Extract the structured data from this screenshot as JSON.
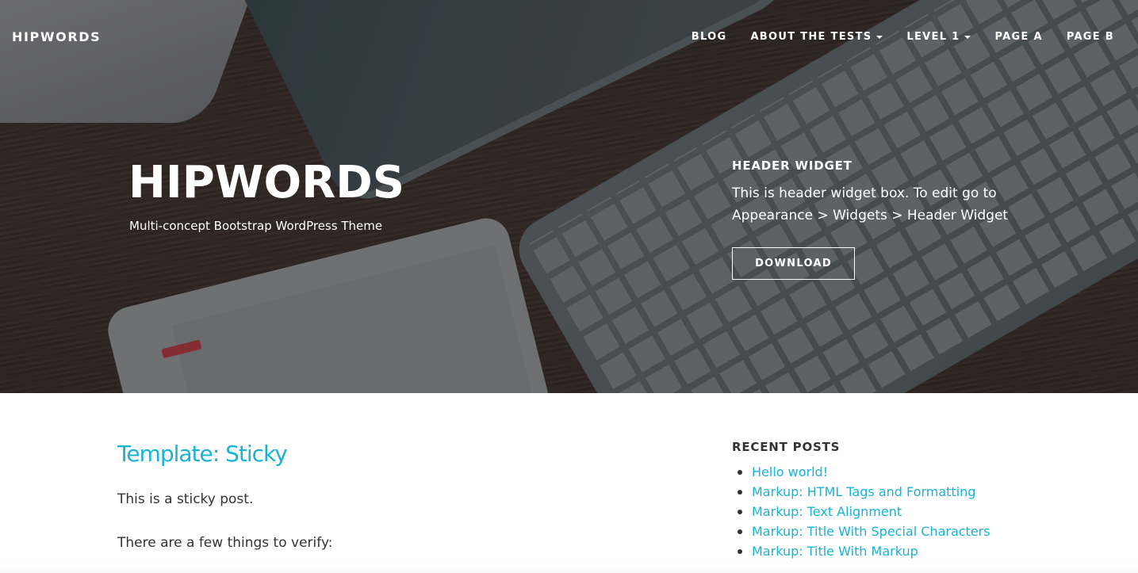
{
  "navbar": {
    "brand": "HIPWORDS",
    "items": [
      {
        "label": "BLOG",
        "has_dropdown": false
      },
      {
        "label": "ABOUT THE TESTS",
        "has_dropdown": true
      },
      {
        "label": "LEVEL 1",
        "has_dropdown": true
      },
      {
        "label": "PAGE A",
        "has_dropdown": false
      },
      {
        "label": "PAGE B",
        "has_dropdown": false
      }
    ]
  },
  "hero": {
    "title": "HIPWORDS",
    "tagline": "Multi-concept Bootstrap WordPress Theme",
    "widget": {
      "title": "HEADER WIDGET",
      "text": "This is header widget box. To edit go to Appearance > Widgets > Header Widget",
      "button_label": "DOWNLOAD"
    }
  },
  "post": {
    "title": "Template: Sticky",
    "paragraphs": [
      "This is a sticky post.",
      "There are a few things to verify:"
    ]
  },
  "sidebar": {
    "recent_posts_title": "RECENT POSTS",
    "recent_posts": [
      "Hello world!",
      "Markup: HTML Tags and Formatting",
      "Markup: Text Alignment",
      "Markup: Title With Special Characters",
      "Markup: Title With Markup"
    ]
  },
  "colors": {
    "accent": "#1ab2d6",
    "text": "#333333",
    "hero_text": "#ffffff"
  }
}
